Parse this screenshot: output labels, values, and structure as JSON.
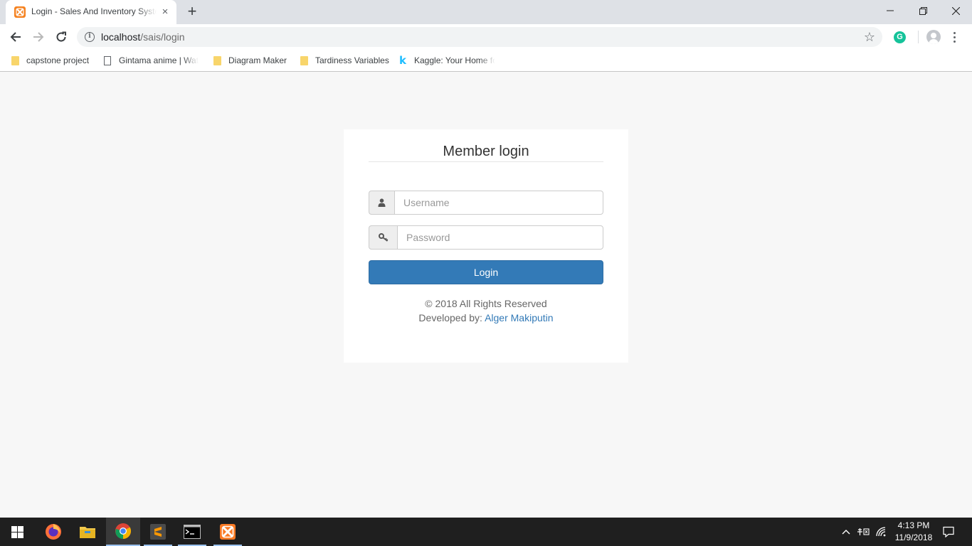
{
  "browser": {
    "tab_title": "Login - Sales And Inventory System",
    "tab_close": "×",
    "new_tab": "+",
    "url_host": "localhost",
    "url_path": "/sais/login",
    "bookmarks": [
      {
        "label": "capstone project",
        "icon": "folder-icon"
      },
      {
        "label": "Gintama anime | Wat",
        "icon": "page-icon"
      },
      {
        "label": "Diagram Maker",
        "icon": "folder-icon"
      },
      {
        "label": "Tardiness Variables",
        "icon": "folder-icon"
      },
      {
        "label": "Kaggle: Your Home fo",
        "icon": "kaggle-icon"
      }
    ],
    "extension_label": "G"
  },
  "login": {
    "title": "Member login",
    "username_placeholder": "Username",
    "password_placeholder": "Password",
    "button_label": "Login",
    "copyright": "© 2018 All Rights Reserved",
    "developed_by_prefix": "Developed by:",
    "developer_name": "Alger Makiputin"
  },
  "taskbar": {
    "time": "4:13 PM",
    "date": "11/9/2018",
    "apps": [
      "windows-start-icon",
      "firefox-icon",
      "file-explorer-icon",
      "chrome-icon",
      "sublime-text-icon",
      "command-prompt-icon",
      "xampp-icon"
    ]
  },
  "colors": {
    "primary": "#337ab7",
    "page_background": "#f7f7f7",
    "taskbar": "#1f1f1f"
  }
}
